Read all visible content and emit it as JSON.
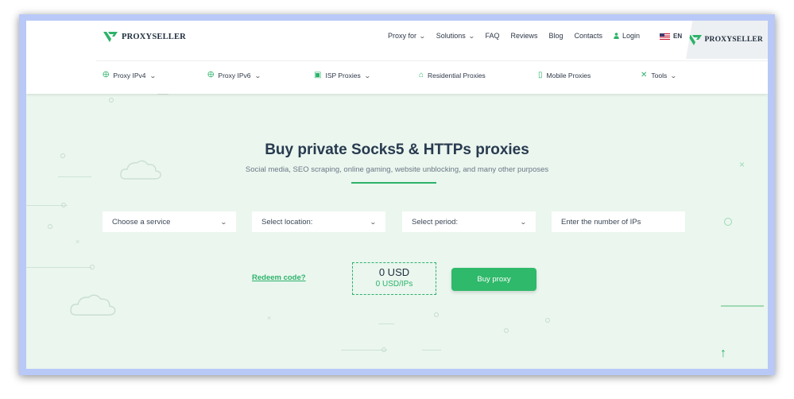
{
  "brand": {
    "name": "PROXYSELLER",
    "color": "#2cb36a"
  },
  "topnav": {
    "proxy_for": "Proxy for",
    "solutions": "Solutions",
    "faq": "FAQ",
    "reviews": "Reviews",
    "blog": "Blog",
    "contacts": "Contacts",
    "login": "Login",
    "language": "EN"
  },
  "subnav": {
    "items": [
      {
        "label": "Proxy IPv4",
        "icon": "globe-icon",
        "dropdown": true
      },
      {
        "label": "Proxy IPv6",
        "icon": "globe-icon",
        "dropdown": true
      },
      {
        "label": "ISP Proxies",
        "icon": "server-icon",
        "dropdown": true
      },
      {
        "label": "Residential Proxies",
        "icon": "home-icon",
        "dropdown": false
      },
      {
        "label": "Mobile Proxies",
        "icon": "mobile-icon",
        "dropdown": false
      },
      {
        "label": "Tools",
        "icon": "tools-icon",
        "dropdown": true
      }
    ]
  },
  "hero": {
    "title": "Buy private Socks5 & HTTPs proxies",
    "subtitle": "Social media, SEO scraping, online gaming, website unblocking, and many other purposes"
  },
  "form": {
    "service": "Choose a service",
    "location": "Select location:",
    "period": "Select period:",
    "ip_count_placeholder": "Enter the number of IPs"
  },
  "checkout": {
    "redeem": "Redeem code?",
    "total": "0 USD",
    "per_ip": "0 USD/IPs",
    "buy": "Buy proxy"
  },
  "colors": {
    "accent": "#2cb36a",
    "background": "#eaf6ee",
    "frame": "#b9c9f7"
  }
}
